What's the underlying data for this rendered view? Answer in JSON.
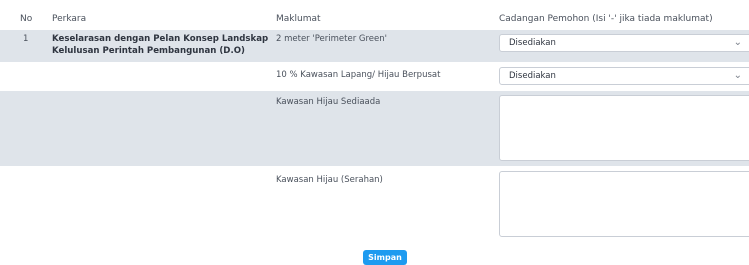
{
  "table": {
    "headers": {
      "no": "No",
      "perkara": "Perkara",
      "maklumat": "Maklumat",
      "cadangan": "Cadangan Pemohon (Isi '-' jika tiada maklumat)"
    },
    "row1": {
      "no": "1",
      "perkara_line1": "Keselarasan dengan Pelan Konsep Landskap",
      "perkara_line2": "Kelulusan Perintah Pembangunan (D.O)",
      "maklumat": "2 meter 'Perimeter Green'",
      "selected": "Disediakan"
    },
    "row2": {
      "maklumat": "10 % Kawasan Lapang/ Hijau Berpusat",
      "selected": "Disediakan"
    },
    "row3": {
      "maklumat": "Kawasan Hijau Sediaada",
      "value": ""
    },
    "row4": {
      "maklumat": "Kawasan Hijau (Serahan)",
      "value": ""
    }
  },
  "actions": {
    "save_label": "Simpan"
  },
  "colors": {
    "row_shade": "#dfe4ea",
    "button": "#1e9bf0"
  },
  "icons": {
    "dropdown": "chevron-down-icon"
  }
}
